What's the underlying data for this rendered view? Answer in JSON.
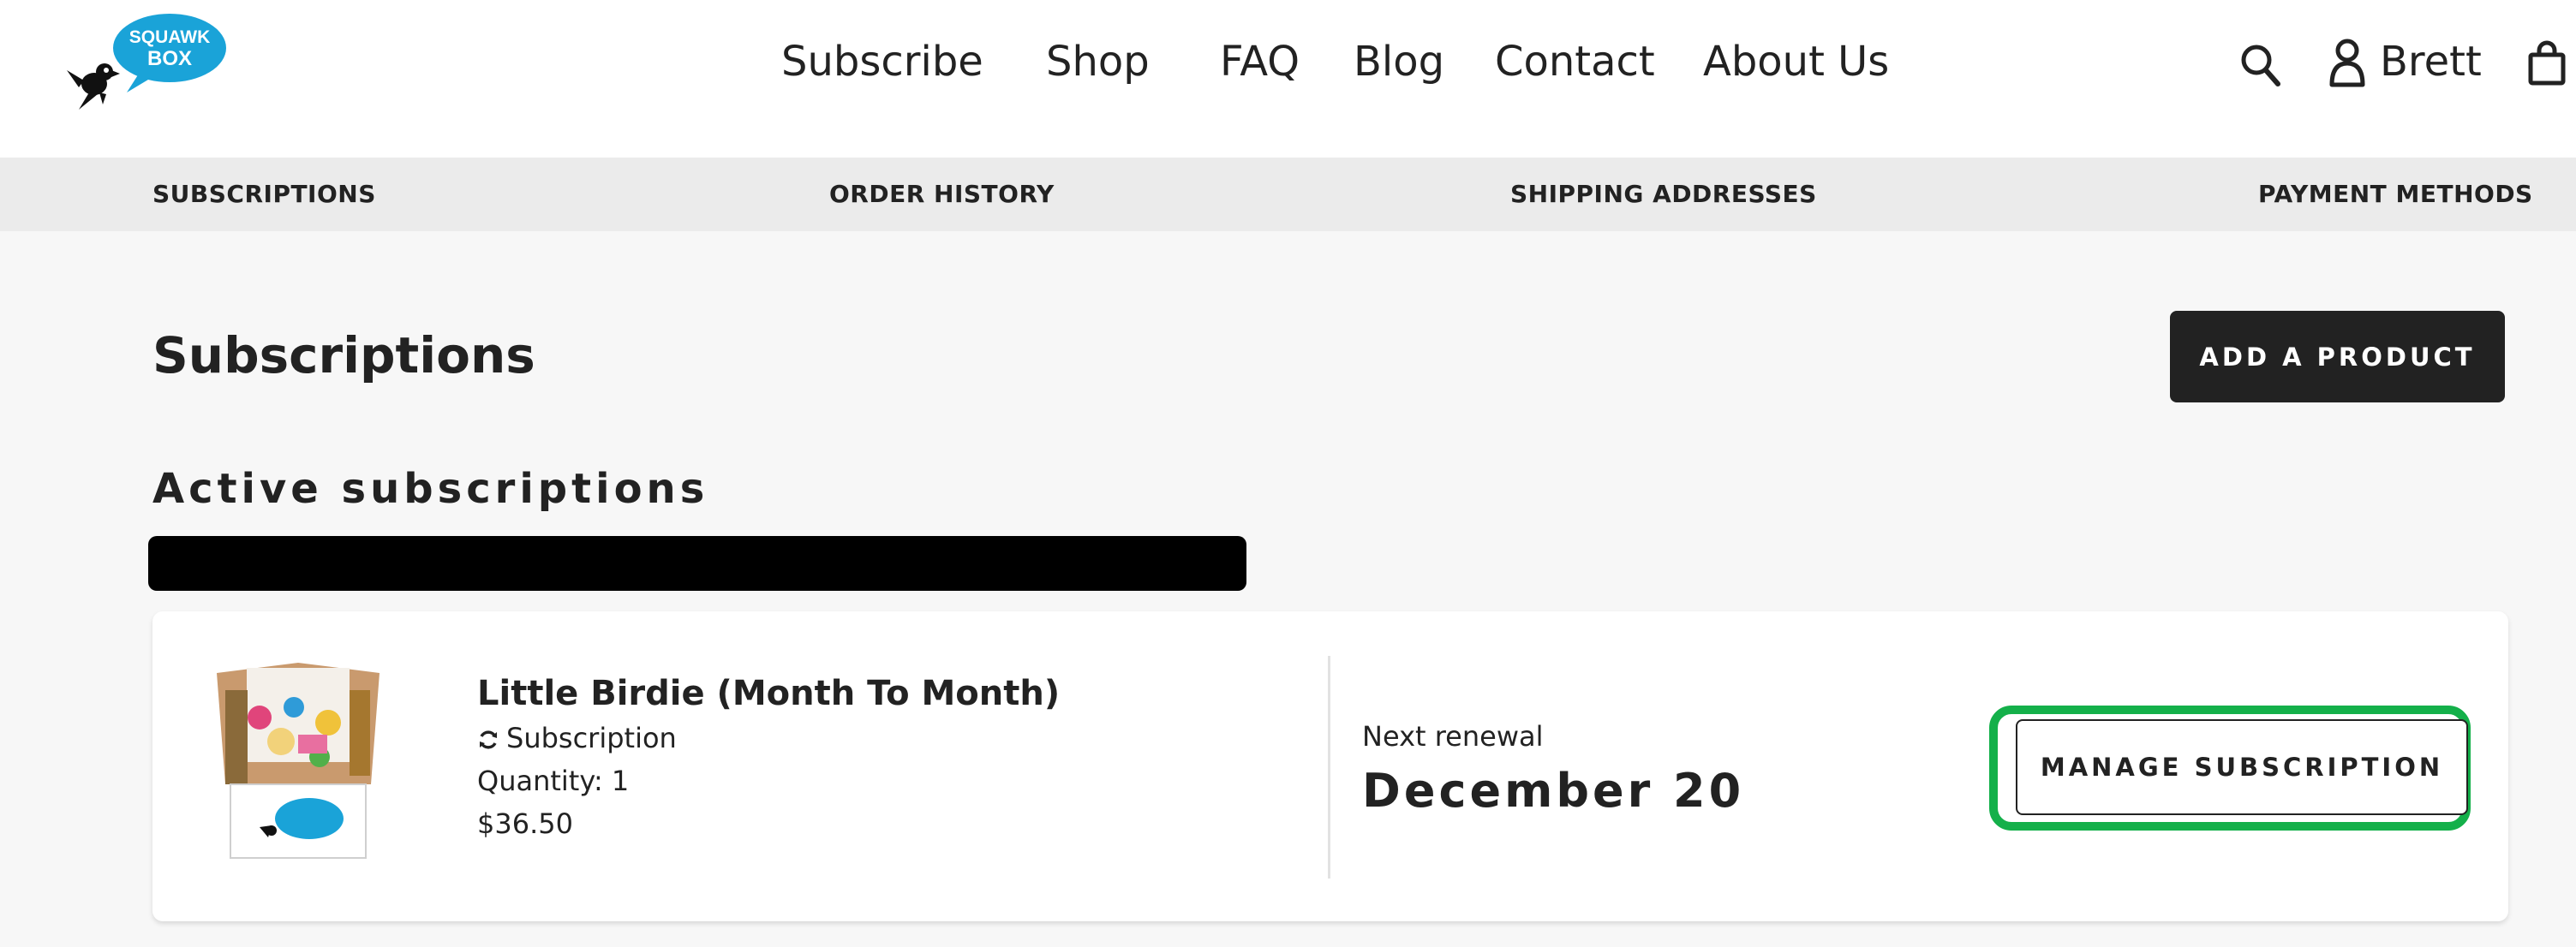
{
  "header": {
    "logo_text": [
      "SQUAWK",
      "BOX"
    ],
    "nav": [
      "Subscribe",
      "Shop",
      "FAQ",
      "Blog",
      "Contact",
      "About Us"
    ],
    "user_name": "Brett",
    "icons": [
      "search-icon",
      "user-icon",
      "cart-icon"
    ]
  },
  "subnav": [
    "SUBSCRIPTIONS",
    "ORDER HISTORY",
    "SHIPPING ADDRESSES",
    "PAYMENT METHODS"
  ],
  "main": {
    "title": "Subscriptions",
    "add_button": "ADD A PRODUCT",
    "section_title": "Active subscriptions"
  },
  "subscription": {
    "name": "Little Birdie (Month To Month)",
    "type": "Subscription",
    "quantity": "Quantity: 1",
    "price": "$36.50",
    "renewal_label": "Next renewal",
    "renewal_date": "December 20",
    "manage_button": "MANAGE SUBSCRIPTION"
  },
  "colors": {
    "brand_blue": "#1aa3d8",
    "button_dark": "#222222",
    "highlight_green": "#14b04a",
    "subnav_bg": "#ebebeb",
    "page_bg": "#f7f7f7"
  }
}
